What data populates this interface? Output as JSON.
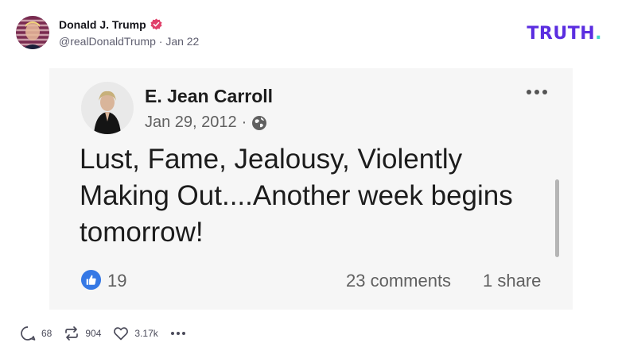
{
  "post": {
    "author_name": "Donald J. Trump",
    "handle": "@realDonaldTrump",
    "separator": "·",
    "date": "Jan 22"
  },
  "brand": {
    "logo_text": "TRUTH",
    "logo_dot": ".",
    "primary_color": "#5b2ee0",
    "dot_color": "#3fd8c7",
    "verified_color": "#e0406a"
  },
  "embed": {
    "name": "E. Jean Carroll",
    "date": "Jan 29, 2012",
    "separator": "·",
    "text": "Lust, Fame, Jealousy, Violently Making Out....Another week begins tomorrow!",
    "likes": "19",
    "comments": "23 comments",
    "shares": "1 share",
    "like_icon_color": "#3578e5"
  },
  "actions": {
    "replies": "68",
    "retruths": "904",
    "likes": "3.17k"
  }
}
